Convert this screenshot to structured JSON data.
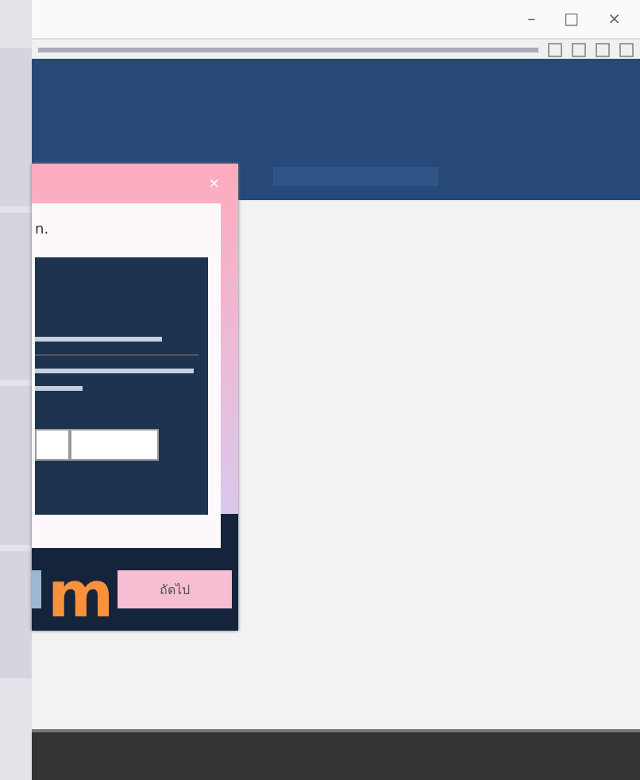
{
  "window_controls": [
    "–",
    "□",
    "×"
  ],
  "dialog": {
    "close": "×",
    "heading": "n.",
    "next_button": "ถัดไป"
  },
  "overlay_letter": "m"
}
